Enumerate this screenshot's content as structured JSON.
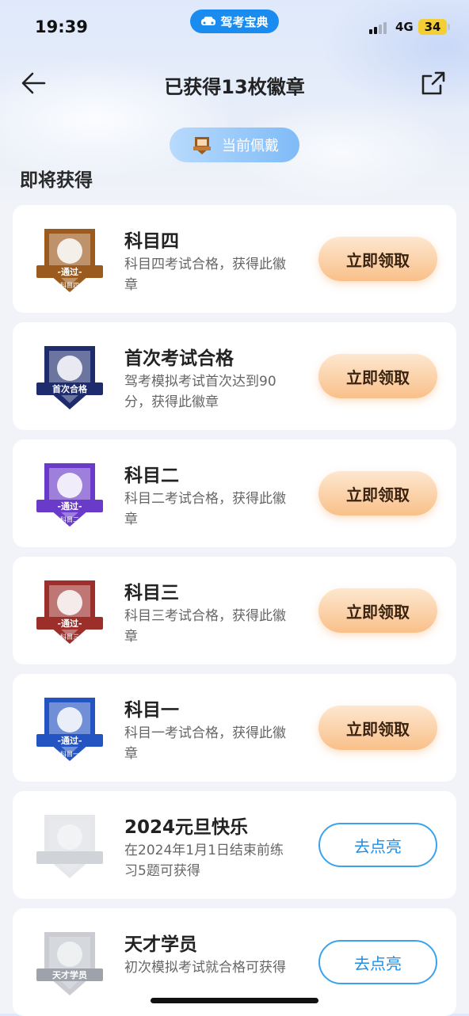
{
  "status_bar": {
    "time": "19:39",
    "app_pill": "驾考宝典",
    "network": "4G",
    "battery": "34"
  },
  "header": {
    "title": "已获得13枚徽章"
  },
  "wearing": {
    "label": "当前佩戴"
  },
  "section": {
    "title": "即将获得"
  },
  "badges": [
    {
      "title": "科目四",
      "desc": "科目四考试合格，获得此徽章",
      "button": "立即领取",
      "style": "claim",
      "color": "#9b5a1e",
      "icon": "subject-four-badge-icon",
      "ribbon": "-通过-",
      "sub": "科目四"
    },
    {
      "title": "首次考试合格",
      "desc": "驾考模拟考试首次达到90分，获得此徽章",
      "button": "立即领取",
      "style": "claim",
      "color": "#1e2c6e",
      "icon": "first-exam-pass-badge-icon",
      "ribbon": "首次合格",
      "sub": ""
    },
    {
      "title": "科目二",
      "desc": "科目二考试合格，获得此徽章",
      "button": "立即领取",
      "style": "claim",
      "color": "#6a3bc9",
      "icon": "subject-two-badge-icon",
      "ribbon": "-通过-",
      "sub": "科目二"
    },
    {
      "title": "科目三",
      "desc": "科目三考试合格，获得此徽章",
      "button": "立即领取",
      "style": "claim",
      "color": "#9c2f2a",
      "icon": "subject-three-badge-icon",
      "ribbon": "-通过-",
      "sub": "科目三"
    },
    {
      "title": "科目一",
      "desc": "科目一考试合格，获得此徽章",
      "button": "立即领取",
      "style": "claim",
      "color": "#2453c2",
      "icon": "subject-one-badge-icon",
      "ribbon": "-通过-",
      "sub": "科目一"
    },
    {
      "title": "2024元旦快乐",
      "desc": "在2024年1月1日结束前练习5题可获得",
      "button": "去点亮",
      "style": "light",
      "color": "#d0d3d8",
      "icon": "new-year-2024-badge-icon",
      "ribbon": "",
      "sub": ""
    },
    {
      "title": "天才学员",
      "desc": "初次模拟考试就合格可获得",
      "button": "去点亮",
      "style": "light",
      "color": "#9ea3ab",
      "icon": "genius-student-badge-icon",
      "ribbon": "天才学员",
      "sub": ""
    }
  ]
}
